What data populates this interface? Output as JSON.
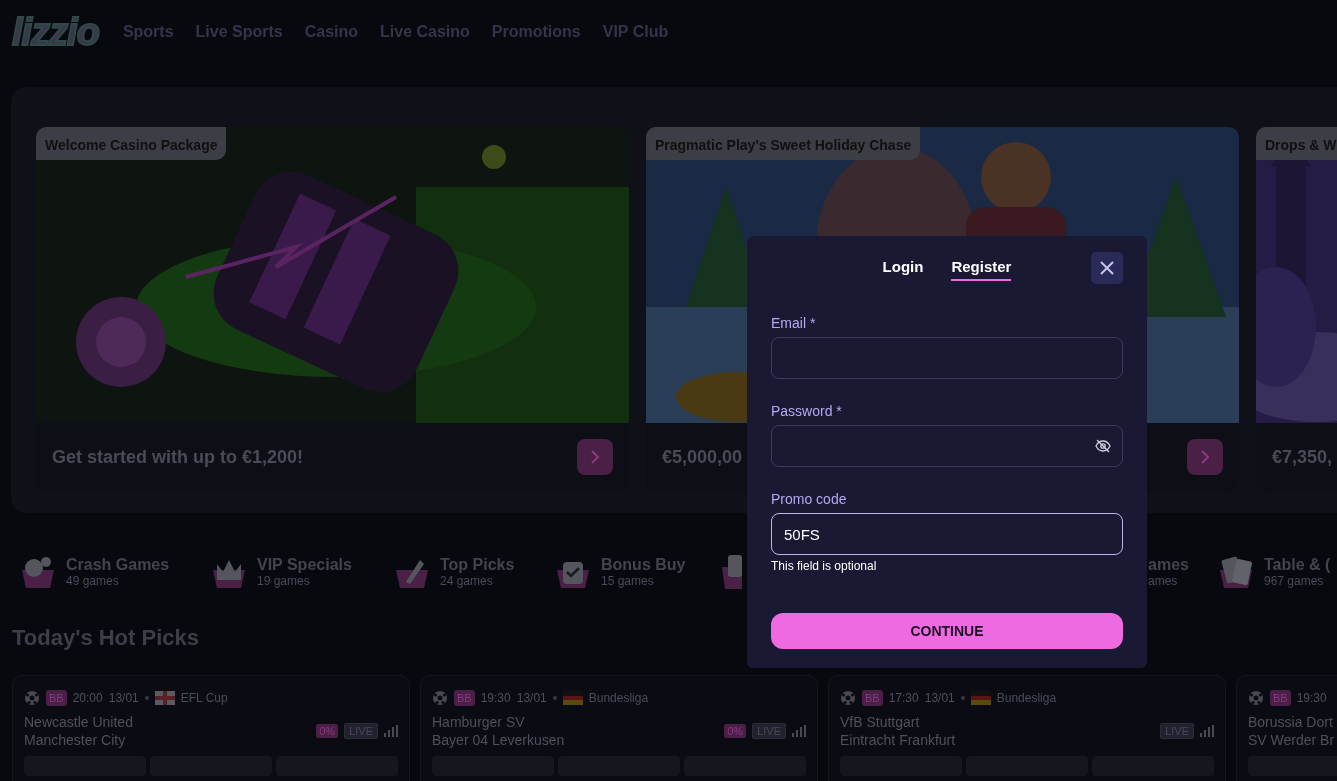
{
  "header": {
    "logo": "lizzio",
    "nav": [
      "Sports",
      "Live Sports",
      "Casino",
      "Live Casino",
      "Promotions",
      "VIP Club"
    ]
  },
  "promos": [
    {
      "title": "Welcome Casino Package",
      "text": "Get started with up to €1,200!"
    },
    {
      "title": "Pragmatic Play's Sweet Holiday Chase",
      "text": "€5,000,00"
    },
    {
      "title": "Drops & W",
      "text": "€7,350,"
    }
  ],
  "categories": [
    {
      "label": "Crash Games",
      "count": "49 games"
    },
    {
      "label": "VIP Specials",
      "count": "19 games"
    },
    {
      "label": "Top Picks",
      "count": "24 games"
    },
    {
      "label": "Bonus Buy",
      "count": "15 games"
    },
    {
      "label": "ames",
      "count": "ames"
    },
    {
      "label": "Table & (",
      "count": "967 games"
    }
  ],
  "hot_picks": {
    "title": "Today's Hot Picks",
    "matches": [
      {
        "badge": "BB",
        "time": "20:00",
        "date": "13/01",
        "league": "EFL Cup",
        "home": "Newcastle United",
        "away": "Manchester City",
        "boost": "0%",
        "live": "LIVE"
      },
      {
        "badge": "BB",
        "time": "19:30",
        "date": "13/01",
        "league": "Bundesliga",
        "home": "Hamburger SV",
        "away": "Bayer 04 Leverkusen",
        "boost": "0%",
        "live": "LIVE"
      },
      {
        "badge": "BB",
        "time": "17:30",
        "date": "13/01",
        "league": "Bundesliga",
        "home": "VfB Stuttgart",
        "away": "Eintracht Frankfurt",
        "live": "LIVE"
      },
      {
        "badge": "BB",
        "time": "19:30",
        "home": "Borussia Dort",
        "away": "SV Werder Br"
      }
    ]
  },
  "modal": {
    "tabs": [
      {
        "label": "Login",
        "selected": false
      },
      {
        "label": "Register",
        "selected": true
      }
    ],
    "fields": [
      {
        "label": "Email *",
        "kind": "text"
      },
      {
        "label": "Password *",
        "kind": "password"
      },
      {
        "label": "Promo code",
        "value": "50FS",
        "kind": "text",
        "hint": "This field is optional"
      }
    ],
    "submit": "CONTINUE"
  }
}
